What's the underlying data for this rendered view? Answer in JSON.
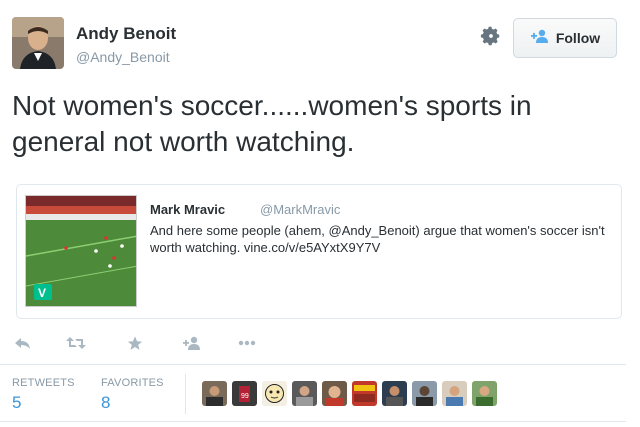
{
  "author": {
    "name": "Andy Benoit",
    "handle": "@Andy_Benoit"
  },
  "header": {
    "follow_label": "Follow",
    "gear_icon": "gear-icon",
    "follow_icon": "add-user-icon"
  },
  "tweet": {
    "text": "Not women's soccer......women's sports in general not worth watching."
  },
  "quoted": {
    "name": "Mark Mravic",
    "handle": "@MarkMravic",
    "text": "And here some people (ahem, @Andy_Benoit) argue that women's soccer isn't worth watching. vine.co/v/e5AYxtX9Y7V"
  },
  "actions": [
    "reply-icon",
    "retweet-icon",
    "favorite-icon",
    "follow-icon",
    "more-icon"
  ],
  "stats": {
    "retweets_label": "RETWEETS",
    "retweets": "5",
    "favorites_label": "FAVORITES",
    "favorites": "8"
  },
  "colors": {
    "link": "#3b94d9",
    "muted": "#8899a6",
    "text": "#292f33",
    "vine": "#00bf8f"
  }
}
